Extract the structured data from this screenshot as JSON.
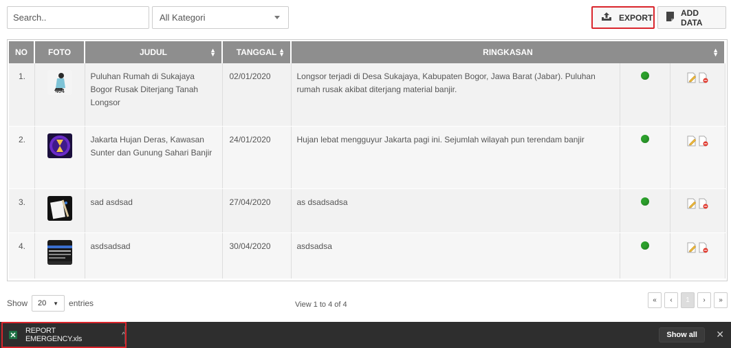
{
  "toolbar": {
    "search_placeholder": "Search..",
    "category_selected": "All Kategori",
    "export_label": "EXPORT",
    "add_label": "ADD DATA"
  },
  "table": {
    "headers": [
      "NO",
      "FOTO",
      "JUDUL",
      "TANGGAL",
      "RINGKASAN"
    ],
    "rows": [
      {
        "no": "1.",
        "judul": "Puluhan Rumah di Sukajaya Bogor Rusak Diterjang Tanah Longsor",
        "tanggal": "02/01/2020",
        "ringkasan": "Longsor terjadi di Desa Sukajaya, Kabupaten Bogor, Jawa Barat (Jabar). Puluhan rumah rusak akibat diterjang material banjir.",
        "thumb_label": "404"
      },
      {
        "no": "2.",
        "judul": "Jakarta Hujan Deras, Kawasan Sunter dan Gunung Sahari Banjir",
        "tanggal": "24/01/2020",
        "ringkasan": "Hujan lebat mengguyur Jakarta pagi ini. Sejumlah wilayah pun terendam banjir"
      },
      {
        "no": "3.",
        "judul": "sad asdsad",
        "tanggal": "27/04/2020",
        "ringkasan": "as dsadsadsa"
      },
      {
        "no": "4.",
        "judul": "asdsadsad",
        "tanggal": "30/04/2020",
        "ringkasan": "asdsadsa"
      }
    ]
  },
  "footer": {
    "show_label": "Show",
    "show_value": "20",
    "entries_label": "entries",
    "view_text": "View 1 to 4 of 4",
    "pager": [
      "«",
      "‹",
      "1",
      "›",
      "»"
    ]
  },
  "downloads": {
    "file_name": "REPORT EMERGENCY.xls",
    "chevron": "^",
    "show_all": "Show all",
    "close": "✕"
  },
  "colors": {
    "header_bg": "#8e8e8e",
    "status_active": "#2ca02c",
    "highlight": "#d9242b",
    "download_bar": "#2e2e2e"
  }
}
